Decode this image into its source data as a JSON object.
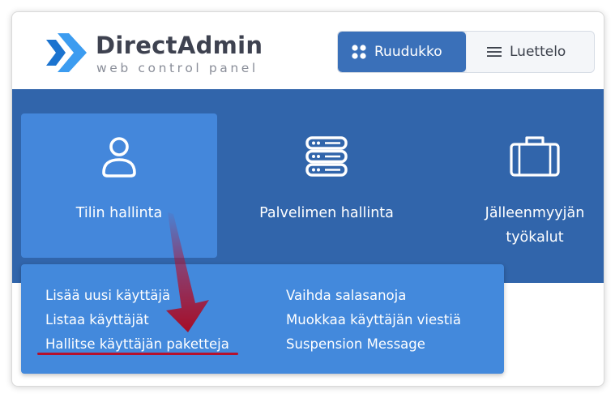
{
  "header": {
    "brand": "DirectAdmin",
    "tagline": "web control panel",
    "logo_icon": "directadmin-logo-icon"
  },
  "view_toggle": {
    "grid_label": "Ruudukko",
    "list_label": "Luettelo",
    "selected": "Ruudukko"
  },
  "tiles": [
    {
      "label": "Tilin hallinta",
      "icon": "user-icon",
      "active": true
    },
    {
      "label": "Palvelimen hallinta",
      "icon": "server-icon",
      "active": false
    },
    {
      "label": "Jälleenmyyjän työkalut",
      "icon": "briefcase-icon",
      "active": false
    }
  ],
  "menu": {
    "left": [
      "Lisää uusi käyttäjä",
      "Listaa käyttäjät",
      "Hallitse käyttäjän paketteja"
    ],
    "right": [
      "Vaihda salasanoja",
      "Muokkaa käyttäjän viestiä",
      "Suspension Message"
    ]
  },
  "colors": {
    "hero_bg": "#3165ab",
    "active_tile": "#4487db",
    "dropdown_bg": "#4389dc",
    "toggle_active": "#3a70b9",
    "annotation": "#b5102c"
  }
}
